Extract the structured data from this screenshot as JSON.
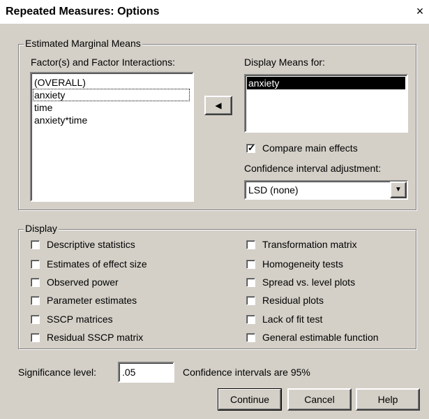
{
  "window": {
    "title": "Repeated Measures: Options",
    "close_glyph": "×"
  },
  "estimated_marginal_means": {
    "group_label": "Estimated Marginal Means",
    "factors_label": "Factor(s) and Factor Interactions:",
    "factors": [
      "(OVERALL)",
      "anxiety",
      "time",
      "anxiety*time"
    ],
    "display_means_label": "Display Means for:",
    "display_means_items": [
      "anxiety"
    ],
    "move_button_glyph": "◀",
    "compare_main_effects": {
      "label": "Compare main effects",
      "checked": true
    },
    "ci_adjustment_label": "Confidence interval adjustment:",
    "ci_adjustment_value": "LSD (none)"
  },
  "display": {
    "group_label": "Display",
    "left_options": [
      {
        "label": "Descriptive statistics",
        "checked": false
      },
      {
        "label": "Estimates of effect size",
        "checked": false
      },
      {
        "label": "Observed power",
        "checked": false
      },
      {
        "label": "Parameter estimates",
        "checked": false
      },
      {
        "label": "SSCP matrices",
        "checked": false
      },
      {
        "label": "Residual SSCP matrix",
        "checked": false
      }
    ],
    "right_options": [
      {
        "label": "Transformation matrix",
        "checked": false
      },
      {
        "label": "Homogeneity tests",
        "checked": false
      },
      {
        "label": "Spread vs. level plots",
        "checked": false
      },
      {
        "label": "Residual plots",
        "checked": false
      },
      {
        "label": "Lack of fit test",
        "checked": false
      },
      {
        "label": "General estimable function",
        "checked": false
      }
    ]
  },
  "significance": {
    "label": "Significance level:",
    "value": ".05",
    "ci_note": "Confidence intervals are 95%"
  },
  "buttons": {
    "continue": "Continue",
    "cancel": "Cancel",
    "help": "Help"
  },
  "colors": {
    "face": "#d4d0c8",
    "selection": "#000000",
    "window_bg": "#ffffff"
  }
}
